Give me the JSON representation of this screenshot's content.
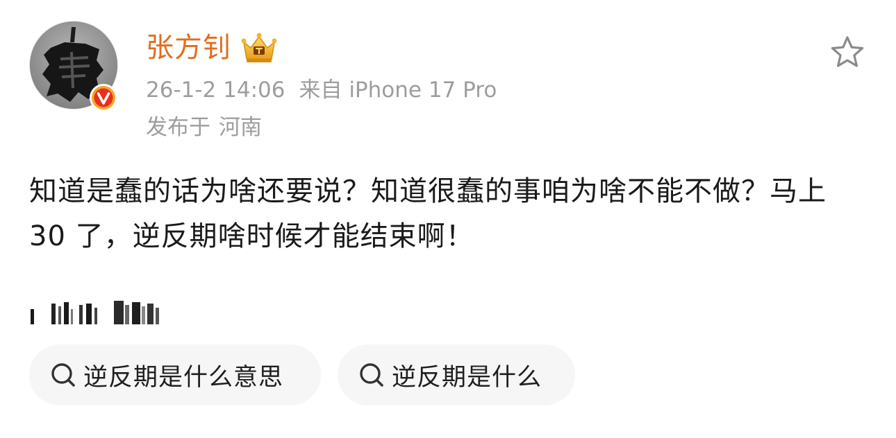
{
  "author": {
    "name": "张方钊",
    "verified_badge": "verified-v-icon",
    "crown_badge": "crown-icon"
  },
  "meta": {
    "datetime": "26-1-2 14:06",
    "source": "来自 iPhone 17 Pro",
    "location_prefix": "发布于",
    "location": "河南"
  },
  "post": {
    "text": "知道是蠢的话为啥还要说？知道很蠢的事咱为啥不能不做？马上 30 了，逆反期啥时候才能结束啊！"
  },
  "actions": {
    "favorite_icon": "star-icon"
  },
  "search_chips": [
    {
      "label": "逆反期是什么意思",
      "icon": "search-icon"
    },
    {
      "label": "逆反期是什么",
      "icon": "search-icon"
    }
  ],
  "colors": {
    "username": "#e06e1d",
    "meta_text": "#9d9d9d",
    "body_text": "#1a1a1a",
    "chip_bg": "#f6f6f6",
    "verified_badge": "#f5a623"
  }
}
